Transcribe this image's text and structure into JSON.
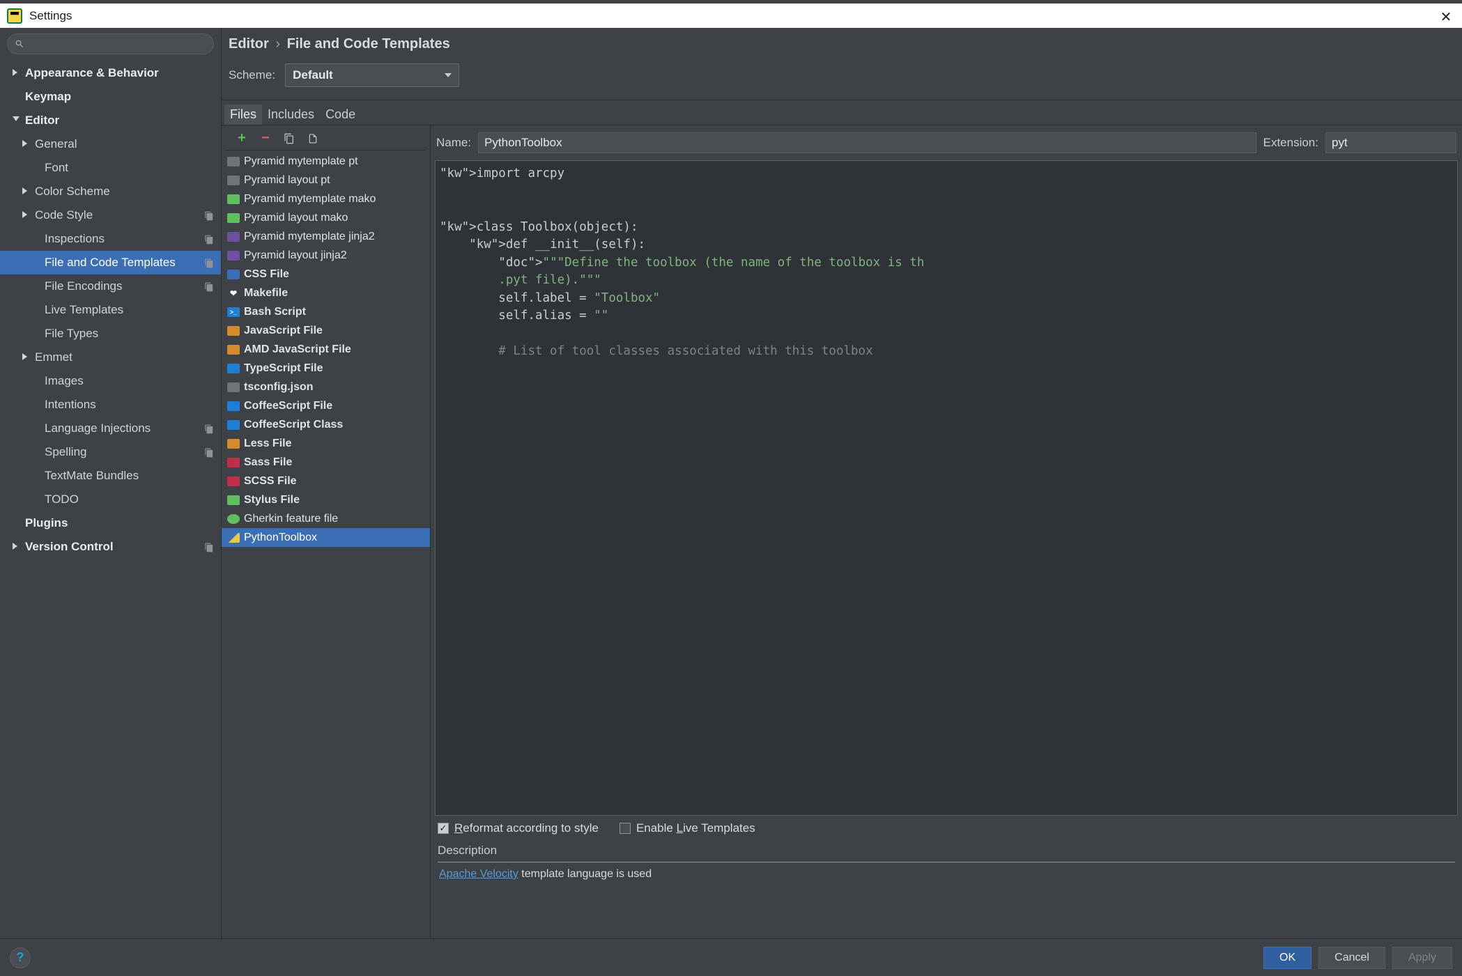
{
  "window": {
    "title": "Settings"
  },
  "breadcrumb": {
    "root": "Editor",
    "leaf": "File and Code Templates"
  },
  "scheme": {
    "label": "Scheme:",
    "value": "Default"
  },
  "tabs": [
    {
      "label": "Files",
      "active": true
    },
    {
      "label": "Includes",
      "active": false
    },
    {
      "label": "Code",
      "active": false
    }
  ],
  "tree": [
    {
      "label": "Appearance & Behavior",
      "depth": 1,
      "arrow": "right"
    },
    {
      "label": "Keymap",
      "depth": 1,
      "arrow": "none"
    },
    {
      "label": "Editor",
      "depth": 1,
      "arrow": "down"
    },
    {
      "label": "General",
      "depth": 2,
      "arrow": "right"
    },
    {
      "label": "Font",
      "depth": 3,
      "arrow": "none"
    },
    {
      "label": "Color Scheme",
      "depth": 2,
      "arrow": "right"
    },
    {
      "label": "Code Style",
      "depth": 2,
      "arrow": "right",
      "proj": true
    },
    {
      "label": "Inspections",
      "depth": 3,
      "arrow": "none",
      "proj": true
    },
    {
      "label": "File and Code Templates",
      "depth": 3,
      "arrow": "none",
      "proj": true,
      "selected": true
    },
    {
      "label": "File Encodings",
      "depth": 3,
      "arrow": "none",
      "proj": true
    },
    {
      "label": "Live Templates",
      "depth": 3,
      "arrow": "none"
    },
    {
      "label": "File Types",
      "depth": 3,
      "arrow": "none"
    },
    {
      "label": "Emmet",
      "depth": 2,
      "arrow": "right"
    },
    {
      "label": "Images",
      "depth": 3,
      "arrow": "none"
    },
    {
      "label": "Intentions",
      "depth": 3,
      "arrow": "none"
    },
    {
      "label": "Language Injections",
      "depth": 3,
      "arrow": "none",
      "proj": true
    },
    {
      "label": "Spelling",
      "depth": 3,
      "arrow": "none",
      "proj": true
    },
    {
      "label": "TextMate Bundles",
      "depth": 3,
      "arrow": "none"
    },
    {
      "label": "TODO",
      "depth": 3,
      "arrow": "none"
    },
    {
      "label": "Plugins",
      "depth": 1,
      "arrow": "none"
    },
    {
      "label": "Version Control",
      "depth": 1,
      "arrow": "right",
      "proj": true
    }
  ],
  "templates": [
    {
      "label": "Pyramid mytemplate pt",
      "icon": "ic-gen"
    },
    {
      "label": "Pyramid layout pt",
      "icon": "ic-gen"
    },
    {
      "label": "Pyramid mytemplate mako",
      "icon": "ic-m"
    },
    {
      "label": "Pyramid layout mako",
      "icon": "ic-m"
    },
    {
      "label": "Pyramid mytemplate jinja2",
      "icon": "ic-j2"
    },
    {
      "label": "Pyramid layout jinja2",
      "icon": "ic-j2"
    },
    {
      "label": "CSS File",
      "icon": "ic-css",
      "bold": true
    },
    {
      "label": "Makefile",
      "icon": "ic-mk",
      "bold": true
    },
    {
      "label": "Bash Script",
      "icon": "ic-sh",
      "bold": true
    },
    {
      "label": "JavaScript File",
      "icon": "ic-js",
      "bold": true
    },
    {
      "label": "AMD JavaScript File",
      "icon": "ic-js",
      "bold": true
    },
    {
      "label": "TypeScript File",
      "icon": "ic-ts",
      "bold": true
    },
    {
      "label": "tsconfig.json",
      "icon": "ic-json",
      "bold": true
    },
    {
      "label": "CoffeeScript File",
      "icon": "ic-cs",
      "bold": true
    },
    {
      "label": "CoffeeScript Class",
      "icon": "ic-cs",
      "bold": true
    },
    {
      "label": "Less File",
      "icon": "ic-less",
      "bold": true
    },
    {
      "label": "Sass File",
      "icon": "ic-sass",
      "bold": true
    },
    {
      "label": "SCSS File",
      "icon": "ic-sass",
      "bold": true
    },
    {
      "label": "Stylus File",
      "icon": "ic-styl",
      "bold": true
    },
    {
      "label": "Gherkin feature file",
      "icon": "ic-gh"
    },
    {
      "label": "PythonToolbox",
      "icon": "ic-py",
      "selected": true
    }
  ],
  "form": {
    "name_label": "Name:",
    "name_value": "PythonToolbox",
    "ext_label": "Extension:",
    "ext_value": "pyt"
  },
  "code": "import arcpy\n\n\nclass Toolbox(object):\n    def __init__(self):\n        \"\"\"Define the toolbox (the name of the toolbox is th\n        .pyt file).\"\"\"\n        self.label = \"Toolbox\"\n        self.alias = \"\"\n\n        # List of tool classes associated with this toolbox",
  "options": {
    "reformat": {
      "label_pre": "",
      "underline": "R",
      "label_post": "eformat according to style",
      "checked": true
    },
    "live": {
      "label_pre": "Enable ",
      "underline": "L",
      "label_post": "ive Templates",
      "checked": false
    }
  },
  "description": {
    "label": "Description",
    "link": "Apache Velocity",
    "text": " template language is used"
  },
  "footer": {
    "ok": "OK",
    "cancel": "Cancel",
    "apply": "Apply"
  }
}
